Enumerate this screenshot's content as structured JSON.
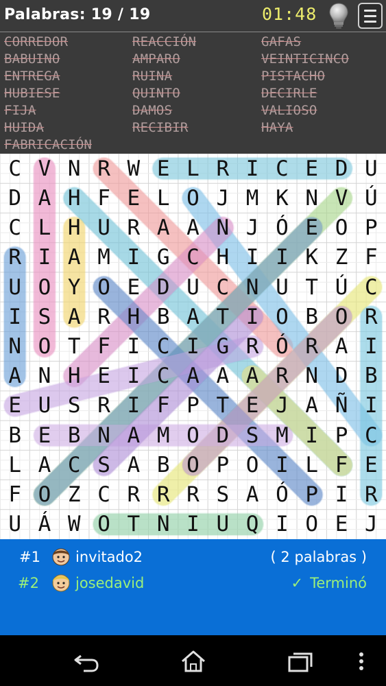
{
  "header": {
    "counter_label": "Palabras: 19 / 19",
    "timer": "01:48"
  },
  "words": [
    [
      "CORREDOR",
      "REACCIÓN",
      "GAFAS"
    ],
    [
      "BABUINO",
      "AMPARO",
      "VEINTICINCO"
    ],
    [
      "ENTREGA",
      "RUINA",
      "PISTACHO"
    ],
    [
      "HUBIESE",
      "QUINTO",
      "DECIRLE"
    ],
    [
      "FIJA",
      "DAMOS",
      "VALIOSO"
    ],
    [
      "HUIDA",
      "RECIBIR",
      "HAYA"
    ],
    [
      "FABRICACIÓN",
      "",
      ""
    ]
  ],
  "grid": [
    "CVNRWELRICEDU",
    "DAHFELOJMKNVÚ",
    "CLHURAANJÓEOP",
    "RIAMIGCHIIKZF",
    "UOYOEDUCNUTÚC",
    "ISARHBATIOBOR",
    "NOTFICIGRÓRAI",
    "ANHEICAAARNDB",
    "EUSRIFPTEJAÑI",
    "BEBNAMODSMIPC",
    "LACSABOPOILFE",
    "FOZCRRRSAÓPIR",
    "UÁWOTNIUQIOEJ"
  ],
  "players": [
    {
      "rank": "#1",
      "name": "invitado2",
      "status": "( 2 palabras )",
      "avatar": "brown-hair-avatar-icon",
      "color": "#ffffff"
    },
    {
      "rank": "#2",
      "name": "josedavid",
      "status": "Terminó",
      "avatar": "blond-hair-avatar-icon",
      "color": "#9cf07a"
    }
  ],
  "colors": {
    "header_bg": "#3a3a3a",
    "timer": "#ecec6c",
    "struck_word": "#b09d9d",
    "players_bg": "#0a6fd6",
    "finished": "#9cf07a"
  },
  "icons": {
    "hint": "lightbulb-icon",
    "menu": "menu-icon",
    "back": "back-icon",
    "home": "home-icon",
    "recents": "recents-icon",
    "overflow": "overflow-icon"
  },
  "found_words": [
    {
      "r1": 0,
      "c1": 5,
      "r2": 0,
      "c2": 11,
      "color": "#7ec8dc"
    },
    {
      "r1": 0,
      "c1": 1,
      "r2": 6,
      "c2": 1,
      "color": "#e98fbf"
    },
    {
      "r1": 0,
      "c1": 3,
      "r2": 6,
      "c2": 9,
      "color": "#ef9a9a"
    },
    {
      "r1": 1,
      "c1": 2,
      "r2": 10,
      "c2": 11,
      "color": "#72c2d8"
    },
    {
      "r1": 1,
      "c1": 6,
      "r2": 9,
      "c2": 12,
      "color": "#7ec0e8"
    },
    {
      "r1": 1,
      "c1": 11,
      "r2": 11,
      "c2": 1,
      "color": "#a8d58a"
    },
    {
      "r1": 2,
      "c1": 2,
      "r2": 5,
      "c2": 2,
      "color": "#f1d36a"
    },
    {
      "r1": 3,
      "c1": 0,
      "r2": 7,
      "c2": 0,
      "color": "#6a9fd8"
    },
    {
      "r1": 2,
      "c1": 7,
      "r2": 7,
      "c2": 2,
      "color": "#d98fc8"
    },
    {
      "r1": 2,
      "c1": 10,
      "r2": 11,
      "c2": 1,
      "color": "#6f94d0"
    },
    {
      "r1": 4,
      "c1": 12,
      "r2": 11,
      "c2": 5,
      "color": "#e5e575"
    },
    {
      "r1": 5,
      "c1": 12,
      "r2": 11,
      "c2": 12,
      "color": "#7ac8e0"
    },
    {
      "r1": 4,
      "c1": 3,
      "r2": 11,
      "c2": 10,
      "color": "#5b88c8"
    },
    {
      "r1": 7,
      "c1": 8,
      "r2": 10,
      "c2": 11,
      "color": "#f5e47a"
    },
    {
      "r1": 5,
      "c1": 11,
      "r2": 10,
      "c2": 6,
      "color": "#b88ed8"
    },
    {
      "r1": 12,
      "c1": 3,
      "r2": 12,
      "c2": 8,
      "color": "#8fd0a5"
    },
    {
      "r1": 6,
      "c1": 8,
      "r2": 8,
      "c2": 0,
      "color": "#c8a8e2"
    },
    {
      "r1": 9,
      "c1": 1,
      "r2": 9,
      "c2": 9,
      "color": "#d0b0e4"
    },
    {
      "r1": 10,
      "c1": 3,
      "r2": 5,
      "c2": 8,
      "color": "#b08fd8"
    }
  ]
}
